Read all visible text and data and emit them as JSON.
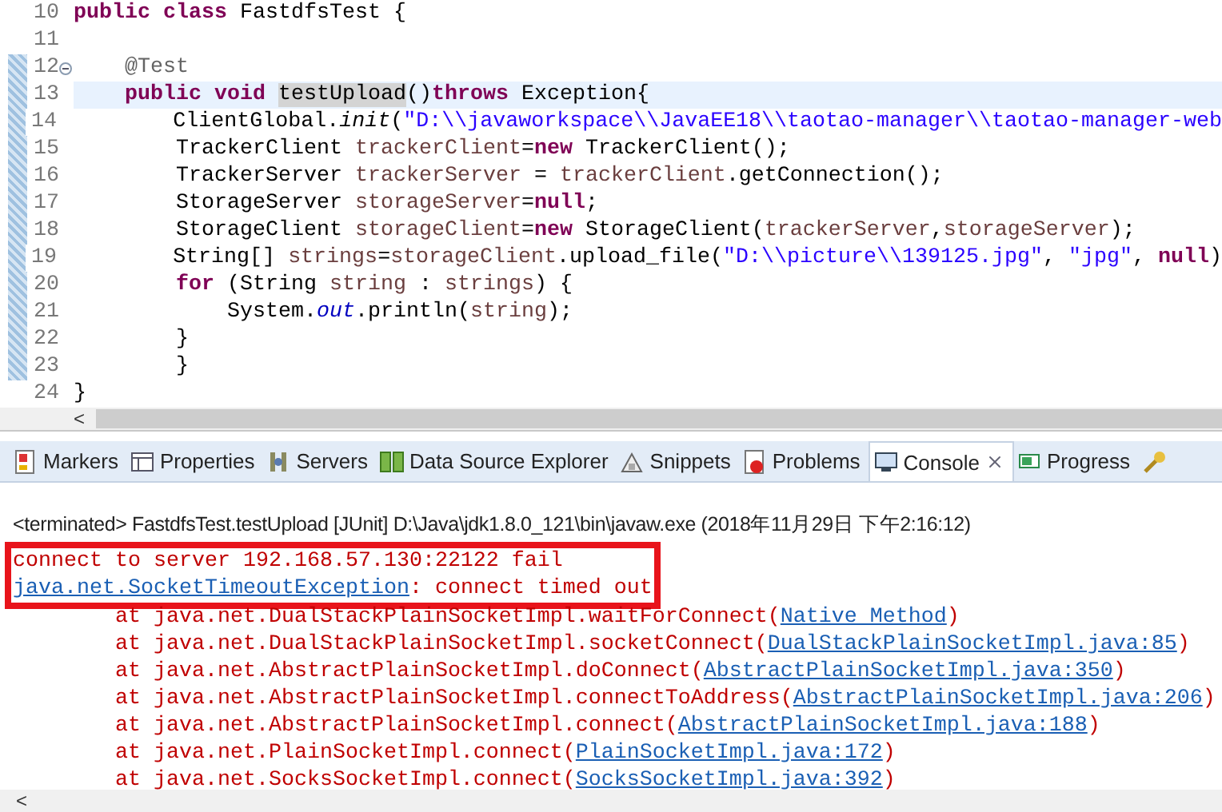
{
  "editor": {
    "lines": [
      {
        "number": "10",
        "current": false,
        "changed": false,
        "collapsible": false,
        "tokens": [
          {
            "kind": "keyword",
            "text": "public class"
          },
          {
            "kind": "plain",
            "text": " FastdfsTest {"
          }
        ]
      },
      {
        "number": "11",
        "current": false,
        "changed": false,
        "collapsible": false
      },
      {
        "number": "12",
        "current": false,
        "changed": true,
        "collapsible": true,
        "tokens": [
          {
            "kind": "annotation",
            "text": "    @Test"
          }
        ]
      },
      {
        "number": "13",
        "current": true,
        "changed": true,
        "collapsible": false,
        "tokens": [
          {
            "kind": "keyword",
            "text": "    public void "
          },
          {
            "kind": "occurrence",
            "text": "testUpload"
          },
          {
            "kind": "plain",
            "text": "()"
          },
          {
            "kind": "keyword",
            "text": "throws"
          },
          {
            "kind": "plain",
            "text": " Exception{"
          }
        ]
      },
      {
        "number": "14",
        "current": false,
        "changed": true,
        "collapsible": false,
        "tokens": [
          {
            "kind": "plain",
            "text": "        ClientGlobal."
          },
          {
            "kind": "static",
            "text": "init"
          },
          {
            "kind": "plain",
            "text": "("
          },
          {
            "kind": "string",
            "text": "\"D:\\\\javaworkspace\\\\JavaEE18\\\\taotao-manager\\\\taotao-manager-web"
          }
        ]
      },
      {
        "number": "15",
        "current": false,
        "changed": true,
        "collapsible": false,
        "tokens": [
          {
            "kind": "plain",
            "text": "        TrackerClient "
          },
          {
            "kind": "local",
            "text": "trackerClient"
          },
          {
            "kind": "plain",
            "text": "="
          },
          {
            "kind": "keyword",
            "text": "new"
          },
          {
            "kind": "plain",
            "text": " TrackerClient();"
          }
        ]
      },
      {
        "number": "16",
        "current": false,
        "changed": true,
        "collapsible": false,
        "tokens": [
          {
            "kind": "plain",
            "text": "        TrackerServer "
          },
          {
            "kind": "local",
            "text": "trackerServer"
          },
          {
            "kind": "plain",
            "text": " = "
          },
          {
            "kind": "local",
            "text": "trackerClient"
          },
          {
            "kind": "plain",
            "text": ".getConnection();"
          }
        ]
      },
      {
        "number": "17",
        "current": false,
        "changed": true,
        "collapsible": false,
        "tokens": [
          {
            "kind": "plain",
            "text": "        StorageServer "
          },
          {
            "kind": "local",
            "text": "storageServer"
          },
          {
            "kind": "plain",
            "text": "="
          },
          {
            "kind": "keyword",
            "text": "null"
          },
          {
            "kind": "plain",
            "text": ";"
          }
        ]
      },
      {
        "number": "18",
        "current": false,
        "changed": true,
        "collapsible": false,
        "tokens": [
          {
            "kind": "plain",
            "text": "        StorageClient "
          },
          {
            "kind": "local",
            "text": "storageClient"
          },
          {
            "kind": "plain",
            "text": "="
          },
          {
            "kind": "keyword",
            "text": "new"
          },
          {
            "kind": "plain",
            "text": " StorageClient("
          },
          {
            "kind": "local",
            "text": "trackerServer"
          },
          {
            "kind": "plain",
            "text": ","
          },
          {
            "kind": "local",
            "text": "storageServer"
          },
          {
            "kind": "plain",
            "text": ");"
          }
        ]
      },
      {
        "number": "19",
        "current": false,
        "changed": true,
        "collapsible": false,
        "tokens": [
          {
            "kind": "plain",
            "text": "        String[] "
          },
          {
            "kind": "local",
            "text": "strings"
          },
          {
            "kind": "plain",
            "text": "="
          },
          {
            "kind": "local",
            "text": "storageClient"
          },
          {
            "kind": "plain",
            "text": ".upload_file("
          },
          {
            "kind": "string",
            "text": "\"D:\\\\picture\\\\139125.jpg\""
          },
          {
            "kind": "plain",
            "text": ", "
          },
          {
            "kind": "string",
            "text": "\"jpg\""
          },
          {
            "kind": "plain",
            "text": ", "
          },
          {
            "kind": "keyword",
            "text": "null"
          },
          {
            "kind": "plain",
            "text": ")"
          }
        ]
      },
      {
        "number": "20",
        "current": false,
        "changed": true,
        "collapsible": false,
        "tokens": [
          {
            "kind": "keyword",
            "text": "        for"
          },
          {
            "kind": "plain",
            "text": " (String "
          },
          {
            "kind": "local",
            "text": "string"
          },
          {
            "kind": "plain",
            "text": " : "
          },
          {
            "kind": "local",
            "text": "strings"
          },
          {
            "kind": "plain",
            "text": ") {"
          }
        ]
      },
      {
        "number": "21",
        "current": false,
        "changed": true,
        "collapsible": false,
        "tokens": [
          {
            "kind": "plain",
            "text": "            System."
          },
          {
            "kind": "field",
            "text": "out"
          },
          {
            "kind": "plain",
            "text": ".println("
          },
          {
            "kind": "local",
            "text": "string"
          },
          {
            "kind": "plain",
            "text": ");"
          }
        ]
      },
      {
        "number": "22",
        "current": false,
        "changed": true,
        "collapsible": false,
        "tokens": [
          {
            "kind": "plain",
            "text": "        }"
          }
        ]
      },
      {
        "number": "23",
        "current": false,
        "changed": true,
        "collapsible": false,
        "tokens": [
          {
            "kind": "plain",
            "text": "        }"
          }
        ]
      },
      {
        "number": "24",
        "current": false,
        "changed": false,
        "collapsible": false,
        "tokens": [
          {
            "kind": "plain",
            "text": "}"
          }
        ]
      }
    ],
    "scroll_left": "<"
  },
  "tabs": [
    {
      "label": "Markers",
      "selected": false
    },
    {
      "label": "Properties",
      "selected": false
    },
    {
      "label": "Servers",
      "selected": false
    },
    {
      "label": "Data Source Explorer",
      "selected": false
    },
    {
      "label": "Snippets",
      "selected": false
    },
    {
      "label": "Problems",
      "selected": false
    },
    {
      "label": "Console",
      "selected": true
    },
    {
      "label": "Progress",
      "selected": false
    },
    {
      "selected": false
    }
  ],
  "console": {
    "header": "<terminated> FastdfsTest.testUpload [JUnit] D:\\Java\\jdk1.8.0_121\\bin\\javaw.exe (2018年11月29日 下午2:16:12)",
    "lines": [
      {
        "boxed": true,
        "tokens": [
          {
            "kind": "error",
            "text": "connect to server 192.168.57.130:22122 fail"
          }
        ]
      },
      {
        "boxed": true,
        "tokens": [
          {
            "kind": "link",
            "text": "java.net.SocketTimeoutException"
          },
          {
            "kind": "error",
            "text": ": connect timed out"
          }
        ]
      },
      {
        "boxed": false,
        "tokens": [
          {
            "kind": "error",
            "text": "        at java.net.DualStackPlainSocketImpl.waitForConnect("
          },
          {
            "kind": "link",
            "text": "Native Method"
          },
          {
            "kind": "error",
            "text": ")"
          }
        ]
      },
      {
        "boxed": false,
        "tokens": [
          {
            "kind": "error",
            "text": "        at java.net.DualStackPlainSocketImpl.socketConnect("
          },
          {
            "kind": "link",
            "text": "DualStackPlainSocketImpl.java:85"
          },
          {
            "kind": "error",
            "text": ")"
          }
        ]
      },
      {
        "boxed": false,
        "tokens": [
          {
            "kind": "error",
            "text": "        at java.net.AbstractPlainSocketImpl.doConnect("
          },
          {
            "kind": "link",
            "text": "AbstractPlainSocketImpl.java:350"
          },
          {
            "kind": "error",
            "text": ")"
          }
        ]
      },
      {
        "boxed": false,
        "tokens": [
          {
            "kind": "error",
            "text": "        at java.net.AbstractPlainSocketImpl.connectToAddress("
          },
          {
            "kind": "link",
            "text": "AbstractPlainSocketImpl.java:206"
          },
          {
            "kind": "error",
            "text": ")"
          }
        ]
      },
      {
        "boxed": false,
        "tokens": [
          {
            "kind": "error",
            "text": "        at java.net.AbstractPlainSocketImpl.connect("
          },
          {
            "kind": "link",
            "text": "AbstractPlainSocketImpl.java:188"
          },
          {
            "kind": "error",
            "text": ")"
          }
        ]
      },
      {
        "boxed": false,
        "tokens": [
          {
            "kind": "error",
            "text": "        at java.net.PlainSocketImpl.connect("
          },
          {
            "kind": "link",
            "text": "PlainSocketImpl.java:172"
          },
          {
            "kind": "error",
            "text": ")"
          }
        ]
      },
      {
        "boxed": false,
        "tokens": [
          {
            "kind": "error",
            "text": "        at java.net.SocksSocketImpl.connect("
          },
          {
            "kind": "link",
            "text": "SocksSocketImpl.java:392"
          },
          {
            "kind": "error",
            "text": ")"
          }
        ]
      }
    ],
    "scroll_left": "<"
  }
}
